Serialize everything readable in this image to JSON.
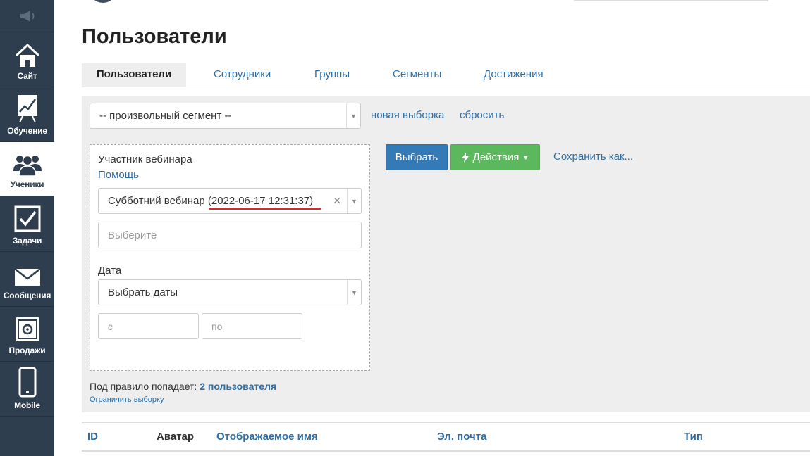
{
  "sidebar": {
    "items": [
      {
        "label": "Сайт",
        "icon": "home-icon"
      },
      {
        "label": "Обучение",
        "icon": "training-chart-icon"
      },
      {
        "label": "Ученики",
        "icon": "users-icon",
        "active": true
      },
      {
        "label": "Задачи",
        "icon": "checkbox-icon"
      },
      {
        "label": "Сообщения",
        "icon": "envelope-icon"
      },
      {
        "label": "Продажи",
        "icon": "safe-icon"
      },
      {
        "label": "Mobile",
        "icon": "smartphone-icon"
      }
    ],
    "top_icon": "megaphone-icon",
    "colors": {
      "background": "#2f3e4e",
      "active_background": "#ffffff"
    }
  },
  "header": {
    "title": "Пользователи"
  },
  "tabs": [
    {
      "label": "Пользователи",
      "active": true
    },
    {
      "label": "Сотрудники"
    },
    {
      "label": "Группы"
    },
    {
      "label": "Сегменты"
    },
    {
      "label": "Достижения"
    }
  ],
  "filter": {
    "segment_select": "-- произвольный сегмент --",
    "new_selection_link": "новая выборка",
    "reset_link": "сбросить",
    "rule": {
      "title": "Участник вебинара",
      "help_link": "Помощь",
      "webinar_select": "Субботний вебинар (2022-06-17 12:31:37)",
      "choose_placeholder": "Выберите",
      "date_label": "Дата",
      "date_select": "Выбрать даты",
      "from_placeholder": "с",
      "to_placeholder": "по"
    },
    "select_button": "Выбрать",
    "actions_button": "Действия",
    "save_as_link": "Сохранить как...",
    "summary_prefix": "Под правило попадает:",
    "summary_count": "2 пользователя",
    "limit_link": "Ограничить выборку"
  },
  "table": {
    "columns": [
      "ID",
      "Аватар",
      "Отображаемое имя",
      "Эл. почта",
      "Тип"
    ]
  },
  "colors": {
    "link": "#2e6da4",
    "primary_button": "#337ab7",
    "success_button": "#5cb85c",
    "highlight_underline": "#d9262b"
  }
}
